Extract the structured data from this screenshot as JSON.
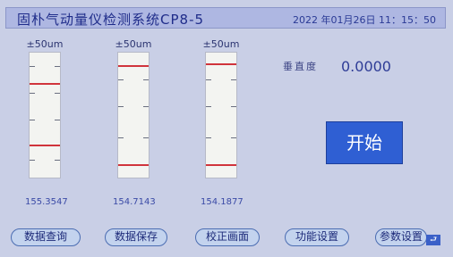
{
  "header": {
    "title": "固朴气动量仪检测系统CP8-5",
    "datetime": "2022 年01月26日  11：15：50"
  },
  "gauges": [
    {
      "range_label": "±50um",
      "value": "155.3547"
    },
    {
      "range_label": "±50um",
      "value": "154.7143"
    },
    {
      "range_label": "±50um",
      "value": "154.1877"
    }
  ],
  "verticality": {
    "label": "垂直度",
    "value": "0.0000"
  },
  "start_button": {
    "label": "开始",
    "color": "#2f5fd3"
  },
  "bottom_buttons": [
    {
      "label": "数据查询"
    },
    {
      "label": "数据保存"
    },
    {
      "label": "校正画面"
    },
    {
      "label": "功能设置"
    },
    {
      "label": "参数设置"
    }
  ],
  "corner_icon": {
    "icon": "back-arrow-icon",
    "glyph": "⮐"
  },
  "colors": {
    "limit_line": "#d0343c",
    "title_text": "#1f2c8a"
  }
}
